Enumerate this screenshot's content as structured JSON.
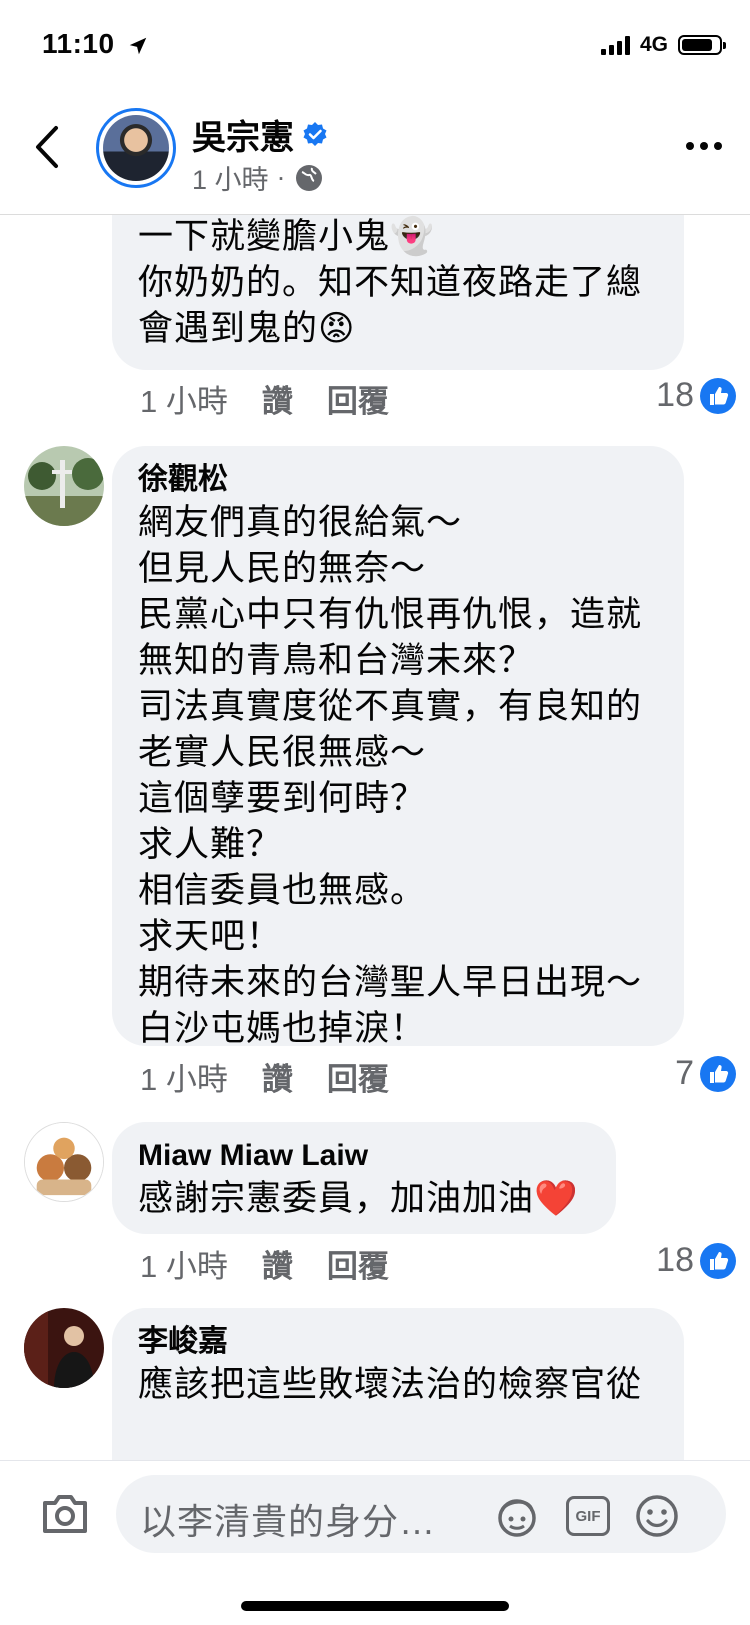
{
  "status": {
    "time": "11:10",
    "network": "4G"
  },
  "header": {
    "page_name": "吳宗憲",
    "timestamp": "1 小時",
    "dot": "·"
  },
  "comments": [
    {
      "body": "一下就變膽小鬼👻\n你奶奶的。知不知道夜路走了總\n會遇到鬼的😡",
      "time": "1 小時",
      "like_label": "讚",
      "reply_label": "回覆",
      "likes": "18"
    },
    {
      "author": "徐觀松",
      "body": "網友們真的很給氣～\n但見人民的無奈～\n民黨心中只有仇恨再仇恨，造就\n無知的青鳥和台灣未來？\n司法真實度從不真實，有良知的\n老實人民很無感～\n這個孽要到何時？\n求人難？\n相信委員也無感。\n求天吧！\n期待未來的台灣聖人早日出現～\n白沙屯媽也掉淚！",
      "time": "1 小時",
      "like_label": "讚",
      "reply_label": "回覆",
      "likes": "7"
    },
    {
      "author": "Miaw Miaw Laiw",
      "body": "感謝宗憲委員，加油加油❤️",
      "time": "1 小時",
      "like_label": "讚",
      "reply_label": "回覆",
      "likes": "18"
    },
    {
      "author": "李峻嘉",
      "body": "應該把這些敗壞法治的檢察官從"
    }
  ],
  "composer": {
    "placeholder": "以李清貴的身分…",
    "gif_label": "GIF"
  },
  "colors": {
    "accent": "#1877f2",
    "bubble": "#f0f2f5",
    "meta": "#65676b"
  },
  "icons": [
    "back-arrow-icon",
    "verified-badge-icon",
    "globe-icon",
    "more-icon",
    "like-thumb-icon",
    "camera-icon",
    "avatar-sticker-icon",
    "gif-icon",
    "emoji-icon",
    "location-arrow-icon"
  ]
}
